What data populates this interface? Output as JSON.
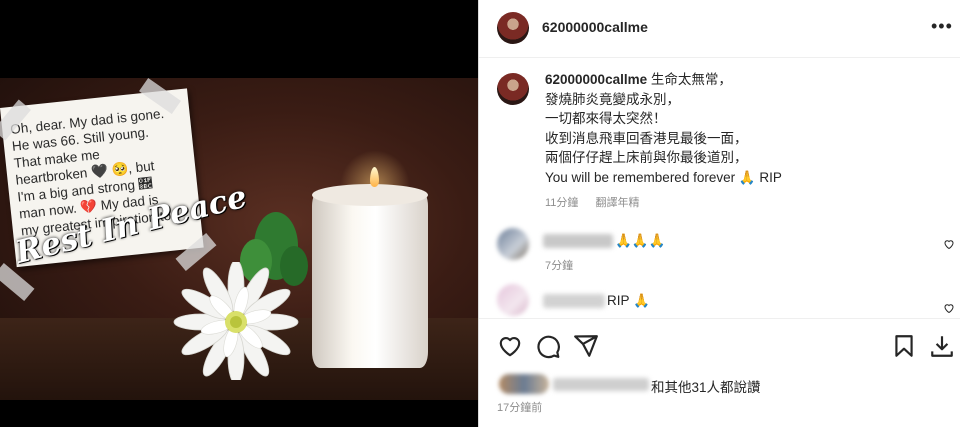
{
  "post": {
    "username": "62000000callme",
    "more_icon": "more-horizontal-icon",
    "image": {
      "note_lines": [
        "Oh, dear. My dad is gone.",
        "He was 66. Still young.",
        "That make me",
        "heartbroken 🖤 🥺, but",
        "I'm a big and strong 🢼",
        "man now. 💔 My dad is",
        "my greatest inspiration to"
      ],
      "overlay_title": "Rest In Peace"
    }
  },
  "caption": {
    "username": "62000000callme",
    "lines": [
      "生命太無常，",
      "發燒肺炎竟變成永別，",
      "一切都來得太突然！",
      "收到消息飛車回香港見最後一面，",
      "兩個仔仔趕上床前與你最後道別，",
      "You will be remembered forever 🙏 RIP"
    ],
    "time": "11分鐘",
    "translate": "翻譯年精"
  },
  "comments": [
    {
      "text": "🙏🙏🙏",
      "time": "7分鐘"
    },
    {
      "text": "RIP 🙏",
      "time": ""
    }
  ],
  "actions": {
    "icons": [
      "heart-icon",
      "comment-icon",
      "share-icon",
      "bookmark-icon",
      "download-icon"
    ]
  },
  "likes": {
    "text": "和其他31人都說讚",
    "time_ago": "17分鐘前"
  },
  "colors": {
    "text": "#262626",
    "muted": "#8e8e8e",
    "border": "#dbdbdb"
  }
}
